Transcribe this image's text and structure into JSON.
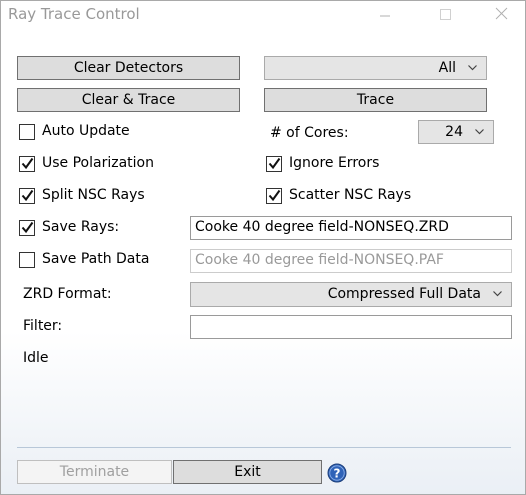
{
  "window": {
    "title": "Ray Trace Control"
  },
  "buttons": {
    "clear_detectors": "Clear Detectors",
    "clear_trace": "Clear & Trace",
    "trace": "Trace",
    "terminate": "Terminate",
    "exit": "Exit"
  },
  "detector_combo": {
    "value": "All"
  },
  "options": {
    "auto_update": {
      "label": "Auto Update",
      "checked": false
    },
    "use_polarization": {
      "label": "Use Polarization",
      "checked": true
    },
    "split_nsc_rays": {
      "label": "Split NSC Rays",
      "checked": true
    },
    "ignore_errors": {
      "label": "Ignore Errors",
      "checked": true
    },
    "scatter_nsc_rays": {
      "label": "Scatter NSC Rays",
      "checked": true
    },
    "save_rays": {
      "label": "Save Rays:",
      "checked": true,
      "value": "Cooke 40 degree field-NONSEQ.ZRD"
    },
    "save_path_data": {
      "label": "Save Path Data",
      "checked": false,
      "value": "Cooke 40 degree field-NONSEQ.PAF"
    }
  },
  "cores": {
    "label": "# of Cores:",
    "value": "24"
  },
  "zrd_format": {
    "label": "ZRD Format:",
    "value": "Compressed Full Data"
  },
  "filter": {
    "label": "Filter:",
    "value": ""
  },
  "status": {
    "text": "Idle"
  },
  "icons": {
    "help": "help-icon",
    "check": "checkmark-icon",
    "dropdown": "chevron-down-icon"
  },
  "colors": {
    "button_face": "#dddddd",
    "help_blue": "#2f63b8"
  }
}
